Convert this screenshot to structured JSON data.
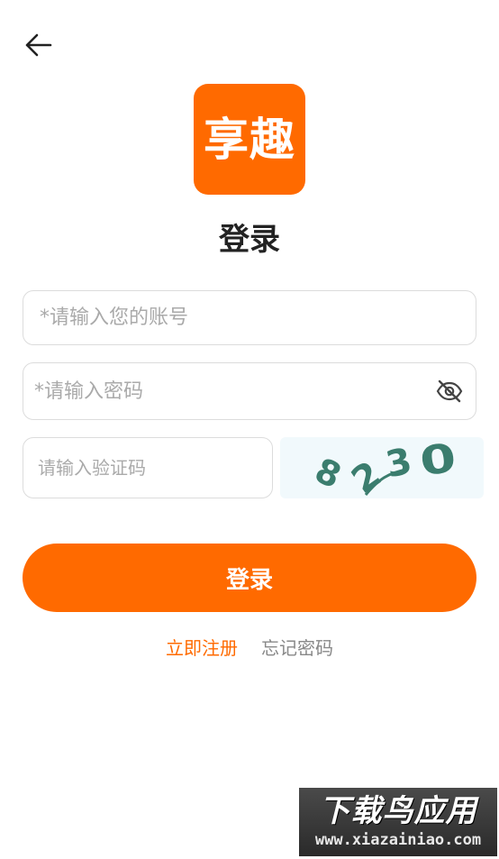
{
  "header": {
    "back_icon": "arrow-left-icon"
  },
  "logo": {
    "text": "享趣",
    "color": "#ff6a00"
  },
  "page": {
    "title": "登录"
  },
  "form": {
    "account_placeholder": "*请输入您的账号",
    "password_placeholder": "*请输入密码",
    "password_toggle_icon": "eye-off-icon",
    "code_placeholder": "请输入验证码",
    "captcha_text": "8230"
  },
  "actions": {
    "login_label": "登录",
    "register_label": "立即注册",
    "forgot_label": "忘记密码",
    "accent_color": "#ff6a00"
  },
  "watermark": {
    "title": "下载鸟应用",
    "url": "www.xiazainiao.com"
  }
}
